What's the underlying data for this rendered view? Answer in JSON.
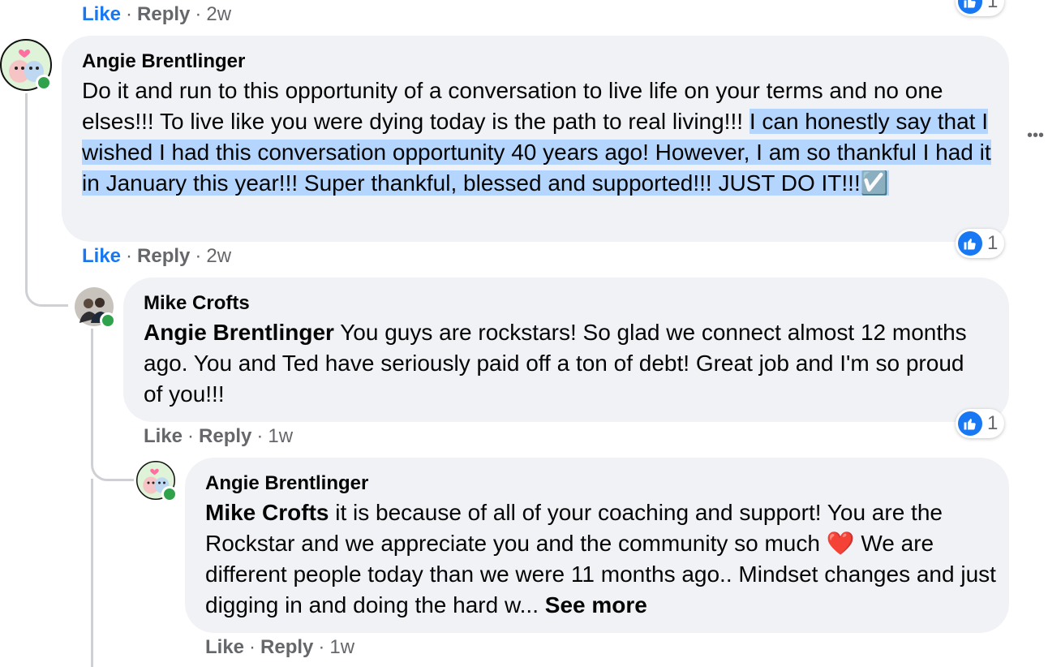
{
  "top_actions": {
    "like": "Like",
    "reply": "Reply",
    "time": "2w",
    "reaction_count": "1"
  },
  "comments": [
    {
      "author": "Angie Brentlinger",
      "text_plain": "Do it and run to this opportunity of a conversation to live life on your terms and no one elses!!! To live like you were dying today is the path to real living!!! ",
      "text_highlighted": "I can honestly say that I wished I had this conversation opportunity 40 years ago! However, I am so thankful I had it in January this year!!! Super thankful, blessed and supported!!! JUST DO IT!!!",
      "emoji": "☑️",
      "like": "Like",
      "reply": "Reply",
      "time": "2w",
      "reaction_count": "1"
    },
    {
      "author": "Mike Crofts",
      "mention": "Angie Brentlinger",
      "text": " You guys are rockstars! So glad we connect almost 12 months ago. You and Ted have seriously paid off a ton of debt! Great job and I'm so proud of you!!!",
      "like": "Like",
      "reply": "Reply",
      "time": "1w",
      "reaction_count": "1"
    },
    {
      "author": "Angie Brentlinger",
      "mention": "Mike Crofts",
      "text_1": " it is because of all of your coaching and support! You are the Rockstar and we appreciate you and the community so much ",
      "emoji": "❤️",
      "text_2": " We are different people today than we were 11 months ago.. Mindset changes and just digging in and doing the hard w... ",
      "see_more": "See more",
      "like": "Like",
      "reply": "Reply",
      "time": "1w"
    }
  ],
  "more_options": "•••",
  "colors": {
    "like_active": "#1877f2",
    "bubble": "#f0f2f5",
    "highlight": "#b4d5fe",
    "online": "#31a24c"
  }
}
